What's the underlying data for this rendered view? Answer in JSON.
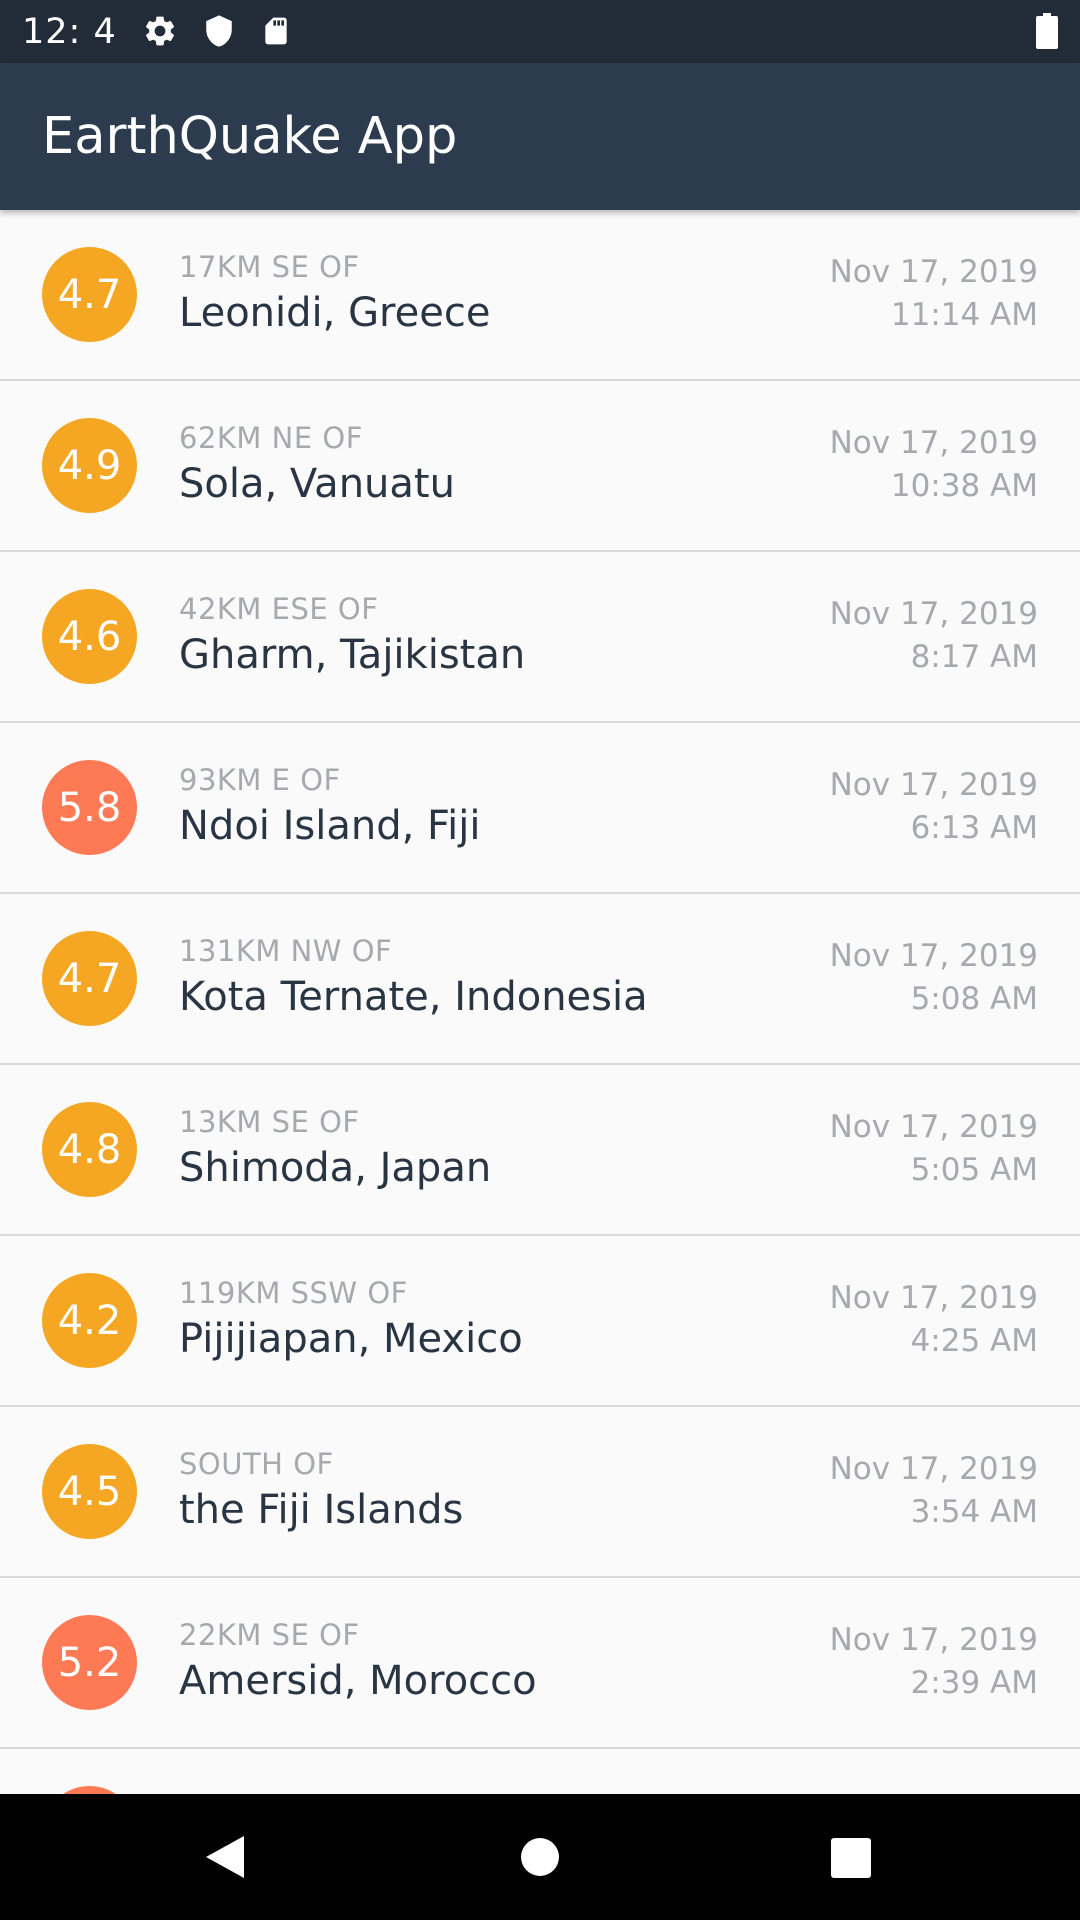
{
  "status_bar": {
    "time": "12: 4",
    "icons": [
      "gear-icon",
      "shield-icon",
      "sd-card-icon",
      "battery-icon"
    ]
  },
  "app_bar": {
    "title": "EarthQuake App"
  },
  "colors": {
    "status_bar_bg": "#222c38",
    "app_bar_bg": "#2c3b4d",
    "mag_orange": "#f5a623",
    "mag_red": "#fd7a55",
    "secondary_text": "#a6a9ae",
    "primary_text": "#2a3543"
  },
  "earthquakes": [
    {
      "magnitude": "4.7",
      "offset": "17KM SE OF",
      "place": "Leonidi, Greece",
      "date": "Nov 17, 2019",
      "time": "11:14 AM",
      "color": "#f5a623"
    },
    {
      "magnitude": "4.9",
      "offset": "62KM NE OF",
      "place": "Sola, Vanuatu",
      "date": "Nov 17, 2019",
      "time": "10:38 AM",
      "color": "#f5a623"
    },
    {
      "magnitude": "4.6",
      "offset": "42KM ESE OF",
      "place": "Gharm, Tajikistan",
      "date": "Nov 17, 2019",
      "time": "8:17 AM",
      "color": "#f5a623"
    },
    {
      "magnitude": "5.8",
      "offset": "93KM E OF",
      "place": "Ndoi Island, Fiji",
      "date": "Nov 17, 2019",
      "time": "6:13 AM",
      "color": "#fd7a55"
    },
    {
      "magnitude": "4.7",
      "offset": "131KM NW OF",
      "place": "Kota Ternate, Indonesia",
      "date": "Nov 17, 2019",
      "time": "5:08 AM",
      "color": "#f5a623"
    },
    {
      "magnitude": "4.8",
      "offset": "13KM SE OF",
      "place": "Shimoda, Japan",
      "date": "Nov 17, 2019",
      "time": "5:05 AM",
      "color": "#f5a623"
    },
    {
      "magnitude": "4.2",
      "offset": "119KM SSW OF",
      "place": "Pijijiapan, Mexico",
      "date": "Nov 17, 2019",
      "time": "4:25 AM",
      "color": "#f5a623"
    },
    {
      "magnitude": "4.5",
      "offset": "SOUTH OF",
      "place": "the Fiji Islands",
      "date": "Nov 17, 2019",
      "time": "3:54 AM",
      "color": "#f5a623"
    },
    {
      "magnitude": "5.2",
      "offset": "22KM SE OF",
      "place": "Amersid, Morocco",
      "date": "Nov 17, 2019",
      "time": "2:39 AM",
      "color": "#fd7a55"
    },
    {
      "magnitude": "",
      "offset": "",
      "place": "",
      "date": "",
      "time": "",
      "color": "#fd7a55"
    }
  ],
  "nav_bar": {
    "buttons": [
      "back-icon",
      "home-icon",
      "recents-icon"
    ]
  }
}
